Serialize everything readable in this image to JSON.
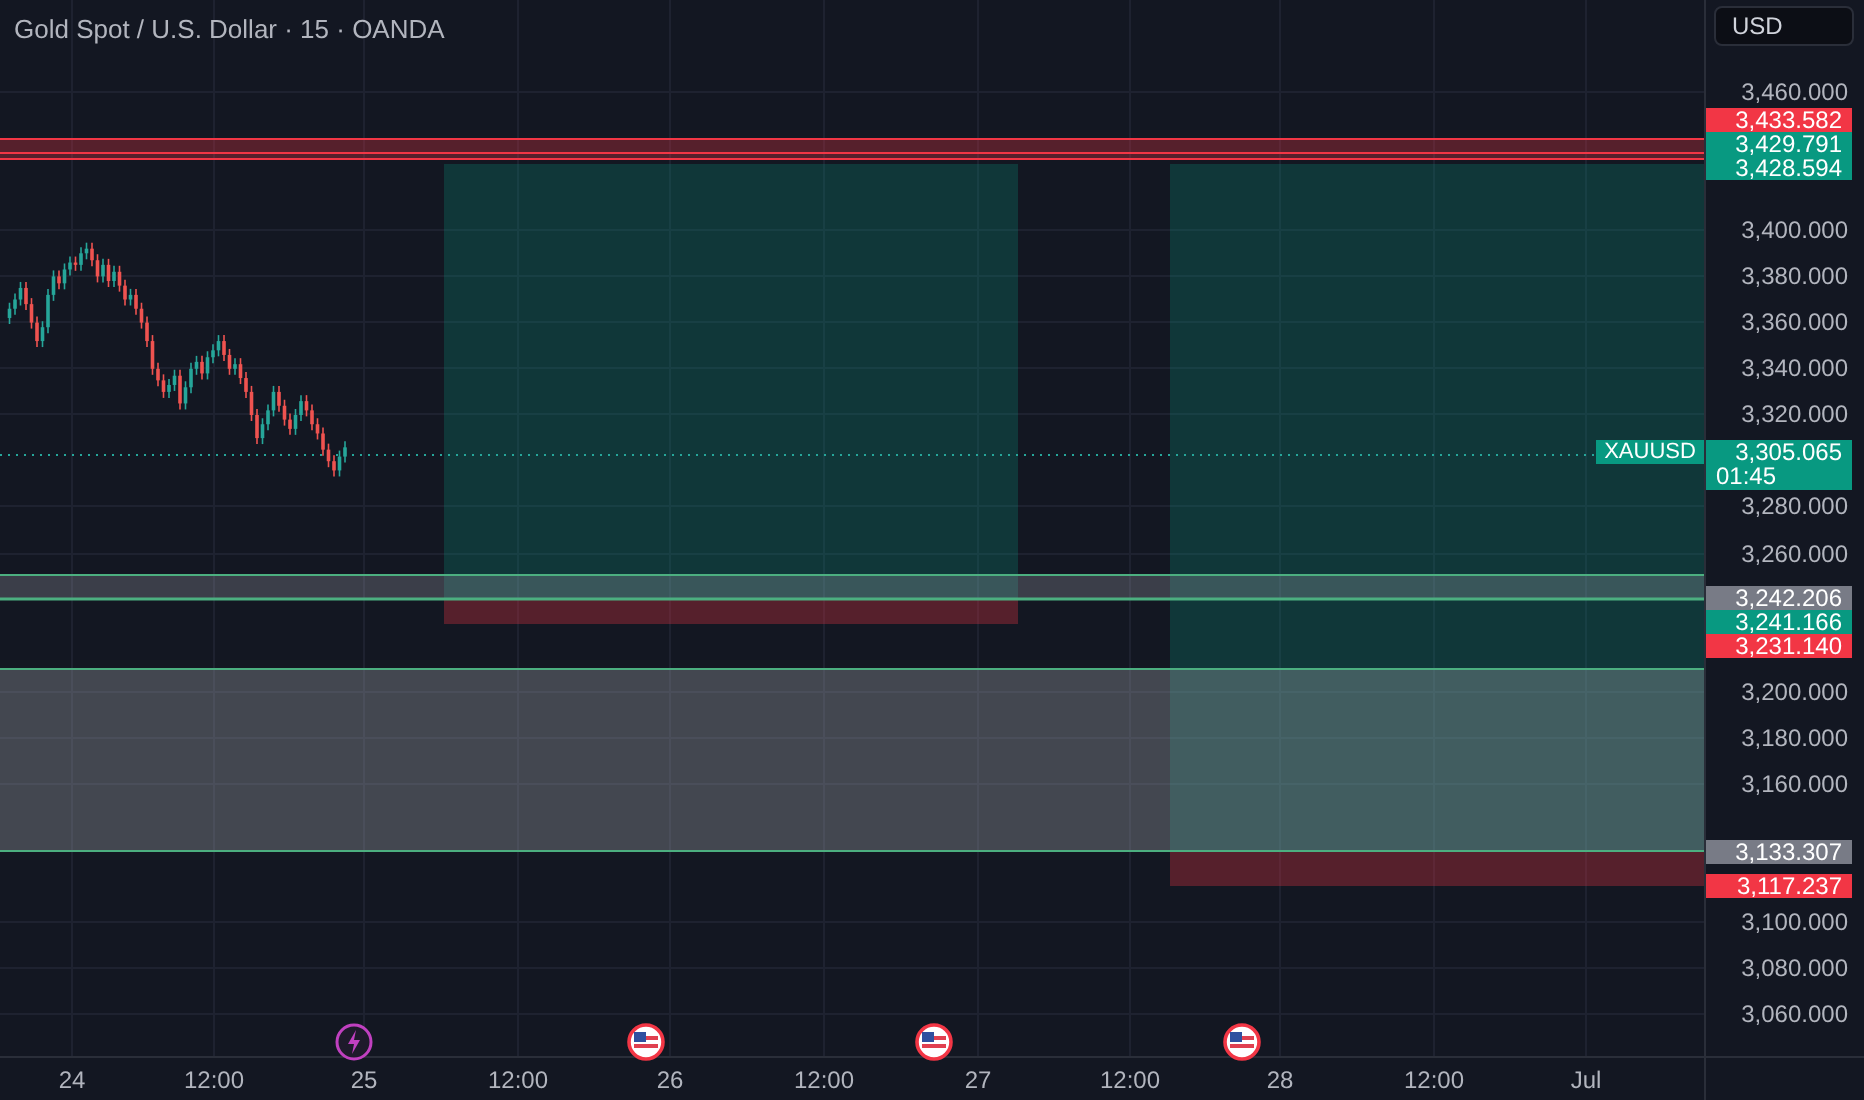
{
  "chart": {
    "title": "Gold Spot / U.S. Dollar · 15 · OANDA",
    "symbol_tag": {
      "label": "XAUUSD",
      "price": "3,305.065",
      "countdown": "01:45"
    }
  },
  "currency_button": "USD",
  "price_axis": {
    "ticks": [
      "3,460.000",
      "3,400.000",
      "3,380.000",
      "3,360.000",
      "3,340.000",
      "3,320.000",
      "3,280.000",
      "3,260.000",
      "3,200.000",
      "3,180.000",
      "3,160.000",
      "3,100.000",
      "3,080.000",
      "3,060.000"
    ]
  },
  "price_tags": [
    {
      "text": "3,433.582",
      "color": "#f23645"
    },
    {
      "text": "3,429.791",
      "color": "#089981"
    },
    {
      "text": "3,428.594",
      "color": "#089981"
    },
    {
      "text": "3,242.206",
      "color": "#787b86"
    },
    {
      "text": "3,241.166",
      "color": "#089981"
    },
    {
      "text": "3,231.140",
      "color": "#f23645"
    },
    {
      "text": "3,133.307",
      "color": "#787b86"
    },
    {
      "text": "3,117.237",
      "color": "#f23645"
    }
  ],
  "events": [
    {
      "kind": "lightning"
    },
    {
      "kind": "flag"
    },
    {
      "kind": "flag"
    },
    {
      "kind": "flag"
    }
  ],
  "time_axis": {
    "labels": [
      "24",
      "12:00",
      "25",
      "12:00",
      "26",
      "12:00",
      "27",
      "12:00",
      "28",
      "12:00",
      "Jul"
    ]
  }
}
